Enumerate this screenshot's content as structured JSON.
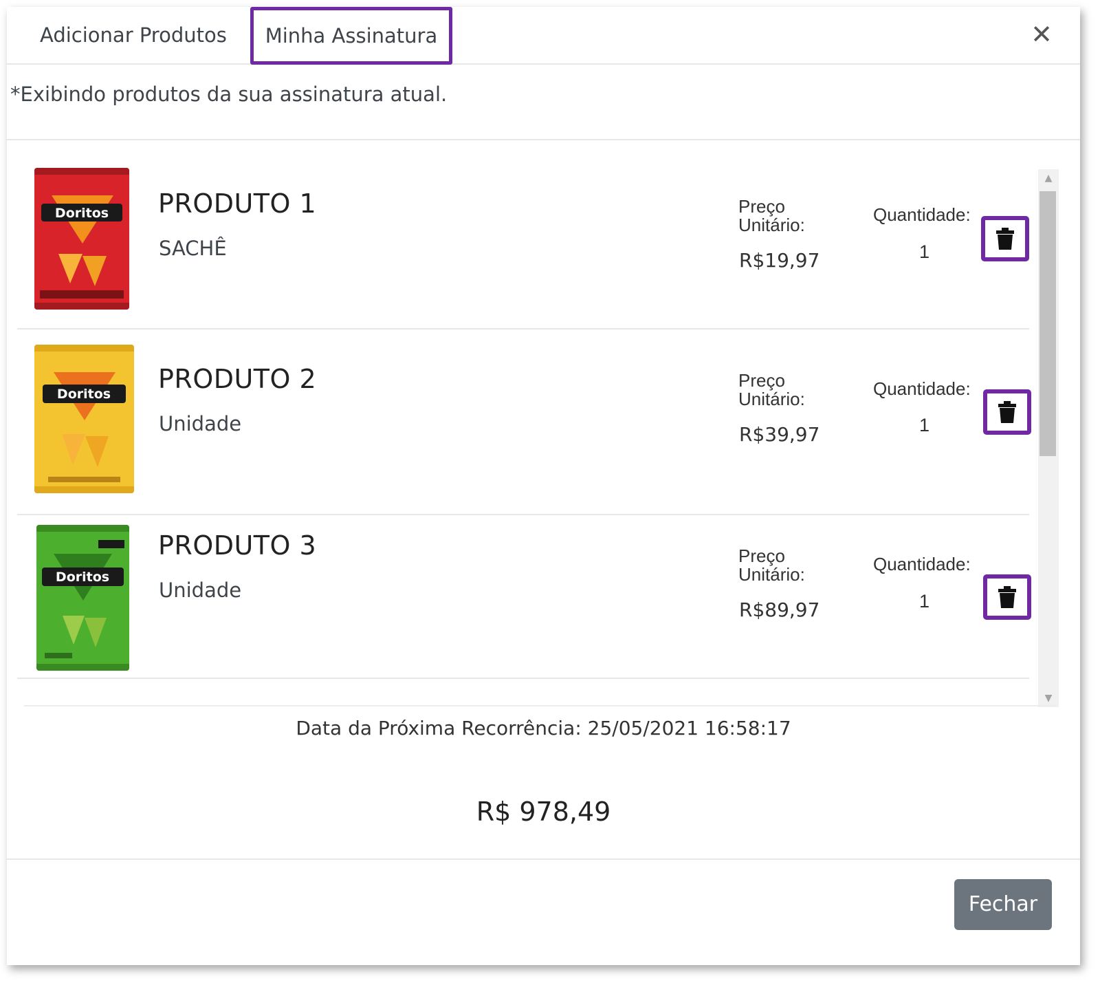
{
  "tabs": {
    "add_label": "Adicionar Produtos",
    "subscription_label": "Minha Assinatura"
  },
  "close_symbol": "✕",
  "info_text": "*Exibindo produtos da sua assinatura atual.",
  "products": [
    {
      "name": "PRODUTO 1",
      "unit": "SACHÊ",
      "price_label": "Preço Unitário:",
      "price": "R$19,97",
      "qty_label": "Quantidade:",
      "qty": "1",
      "image_icon": "doritos-bag-red-icon",
      "image_text": "Doritos",
      "bag_color": "#d8232a"
    },
    {
      "name": "PRODUTO 2",
      "unit": "Unidade",
      "price_label": "Preço Unitário:",
      "price": "R$39,97",
      "qty_label": "Quantidade:",
      "qty": "1",
      "image_icon": "doritos-bag-yellow-icon",
      "image_text": "Doritos",
      "bag_color": "#f4c430"
    },
    {
      "name": "PRODUTO 3",
      "unit": "Unidade",
      "price_label": "Preço Unitário:",
      "price": "R$89,97",
      "qty_label": "Quantidade:",
      "qty": "1",
      "image_icon": "doritos-bag-green-icon",
      "image_text": "Doritos",
      "bag_color": "#4caf2e"
    }
  ],
  "recurrence_text": "Data da Próxima Recorrência: 25/05/2021 16:58:17",
  "total": "R$ 978,49",
  "close_button_label": "Fechar",
  "colors": {
    "highlight": "#6f2aa3",
    "secondary_button": "#6c757d"
  }
}
